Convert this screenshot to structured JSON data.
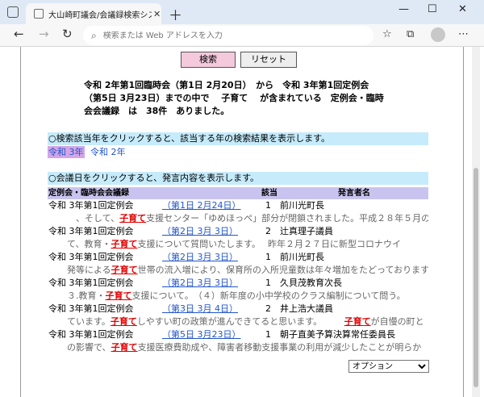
{
  "browser": {
    "tab_title": "大山崎町議会/会議録検索システム",
    "tab_close": "✕",
    "new_tab": "＋",
    "window_controls": [
      "—",
      "☐",
      "✕"
    ],
    "address_placeholder": "検索または Web アドレスを入力",
    "nav": {
      "back": "←",
      "forward": "→",
      "reload": "↻"
    },
    "toolbar_icons": [
      "☆",
      "⧉",
      "♡",
      "⋯"
    ]
  },
  "page": {
    "search_button": "検索",
    "reset_button": "リセット",
    "summary_lines": [
      "令和 2年第1回臨時会（第1日 2月20日）　から　令和 3年第1回定例会",
      "（第5日 3月23日）までの中で　 子育て　 が含まれている　定例会・臨時",
      "会会議録　は　38件　ありました。"
    ],
    "year_instruction": "○検索該当年をクリックすると、該当する年の検索結果を表示します。",
    "year_links": [
      "令和 3年",
      "令和 2年"
    ],
    "day_instruction": "○会議日をクリックすると、発言内容を表示します。",
    "table_headers": {
      "meeting": "定例会・臨時会会議録",
      "hit": "該当",
      "speaker": "発言者名"
    },
    "results": [
      {
        "meeting": "令和 3年第1回定例会",
        "date": "（第1日 2月24日）",
        "count": "1",
        "speaker": "前川光町長",
        "snippet": [
          "　、そして、",
          "子育て",
          "支援センター「ゆめほっぺ」部分が閉鎖されました。平成２８年５月の"
        ]
      },
      {
        "meeting": "令和 3年第1回定例会",
        "date": "（第2日 3月 3日）",
        "count": "2",
        "speaker": "辻真理子議員",
        "snippet": [
          "て、教育・",
          "子育て",
          "支援について質問いたします。　 昨年２月２７日に新型コロナウイ"
        ]
      },
      {
        "meeting": "令和 3年第1回定例会",
        "date": "（第2日 3月 3日）",
        "count": "1",
        "speaker": "前川光町長",
        "snippet": [
          "発等による",
          "子育て",
          "世帯の流入増により、保育所の入所児童数は年々増加をたどっております"
        ]
      },
      {
        "meeting": "令和 3年第1回定例会",
        "date": "（第2日 3月 3日）",
        "count": "1",
        "speaker": "久貝茂教育次長",
        "snippet": [
          "３.教育・",
          "子育て",
          "支援について。　（４）新年度の小中学校のクラス編制について問う。"
        ]
      },
      {
        "meeting": "令和 3年第1回定例会",
        "date": "（第3日 3月 4日）",
        "count": "2",
        "speaker": "井上浩大議員",
        "snippet": [
          "ています。",
          "子育て",
          "しやすい町の政策が進んできてると思います。　　　",
          "子育て",
          "が自慢の町と"
        ]
      },
      {
        "meeting": "令和 3年第1回定例会",
        "date": "（第5日 3月23日）",
        "count": "1",
        "speaker": "朝子直美予算決算常任委員長",
        "snippet": [
          "の影響で、",
          "子育て",
          "支援医療費助成や、障害者移動支援事業の利用が減少したことが明らか"
        ]
      }
    ],
    "options_select": "オプション"
  }
}
